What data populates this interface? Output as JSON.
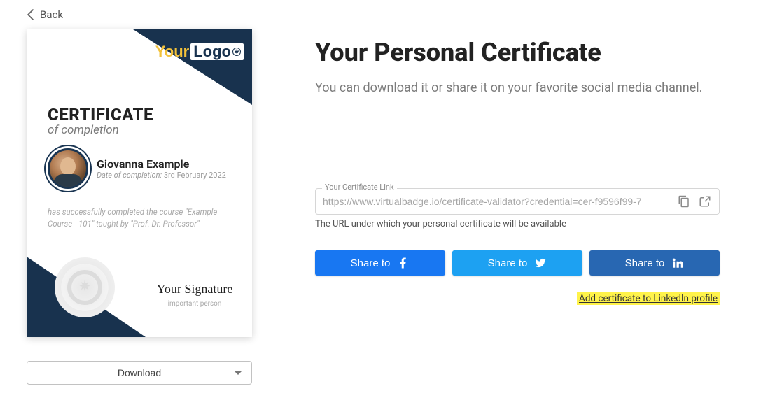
{
  "back_label": "Back",
  "certificate": {
    "logo_word1": "Your",
    "logo_word2": "Logo",
    "title": "CERTIFICATE",
    "subtitle": "of completion",
    "recipient_name": "Giovanna Example",
    "date_label": "Date of completion:",
    "date_value": "3rd February 2022",
    "description": "has successfully completed the course \"Example Course - 101\" taught by \"Prof. Dr. Professor\"",
    "signature_text": "Your Signature",
    "signature_role": "important person"
  },
  "download_label": "Download",
  "page": {
    "title": "Your Personal Certificate",
    "subtitle": "You can download it or share it on your favorite social media channel."
  },
  "link": {
    "legend": "Your Certificate Link",
    "value": "https://www.virtualbadge.io/certificate-validator?credential=cer-f9596f99-7",
    "help": "The URL under which your personal certificate will be available"
  },
  "share": {
    "label": "Share to",
    "linkedin_add": "Add certificate to LinkedIn profile"
  }
}
